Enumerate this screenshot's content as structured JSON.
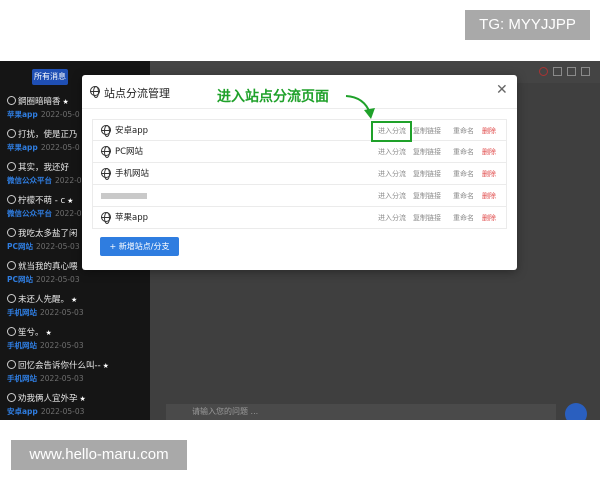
{
  "watermarks": {
    "top": "TG: MYYJJPP",
    "bottom": "www.hello-maru.com"
  },
  "sidebar": {
    "filter_label": "所有消息",
    "chats": [
      {
        "title": "鋼圈暗暗香",
        "starred": true,
        "source": "苹果app",
        "date": "2022-05-0"
      },
      {
        "title": "打扰，使是正乃",
        "starred": false,
        "source": "苹果app",
        "date": "2022-05-0"
      },
      {
        "title": "其实，我还好",
        "starred": false,
        "source": "微信公众平台",
        "date": "2022-05"
      },
      {
        "title": "柠檬不萌 - c",
        "starred": true,
        "source": "微信公众平台",
        "date": "2022-05"
      },
      {
        "title": "我吃太多盐了闲",
        "starred": false,
        "source": "PC网站",
        "date": "2022-05-03"
      },
      {
        "title": "就当我的真心喂",
        "starred": false,
        "source": "PC网站",
        "date": "2022-05-03"
      },
      {
        "title": "未还人先醒。",
        "starred": true,
        "source": "手机网站",
        "date": "2022-05-03"
      },
      {
        "title": "笙兮。",
        "starred": true,
        "source": "手机网站",
        "date": "2022-05-03"
      },
      {
        "title": "回忆会告诉你什么叫--",
        "starred": true,
        "source": "手机网站",
        "date": "2022-05-03"
      },
      {
        "title": "劝我俩人宜外孕",
        "starred": true,
        "source": "安卓app",
        "date": "2022-05-03"
      }
    ]
  },
  "main": {
    "input_placeholder": "请输入您的问题 ..."
  },
  "modal": {
    "title": "站点分流管理",
    "close_symbol": "✕",
    "annotation": "进入站点分流页面",
    "sites": [
      {
        "name": "安卓app"
      },
      {
        "name": "PC网站"
      },
      {
        "name": "手机网站"
      },
      {
        "name": ""
      },
      {
        "name": "苹果app"
      }
    ],
    "actions": {
      "enter": "进入分流",
      "copy": "复制链接",
      "rename": "重命名",
      "delete": "删除"
    },
    "add_button": "+ 新增站点/分支"
  },
  "colors": {
    "accent_green": "#1fa12a",
    "primary_blue": "#2f7de0",
    "delete_red": "#e04a4a",
    "sidebar_bg": "#151515"
  }
}
